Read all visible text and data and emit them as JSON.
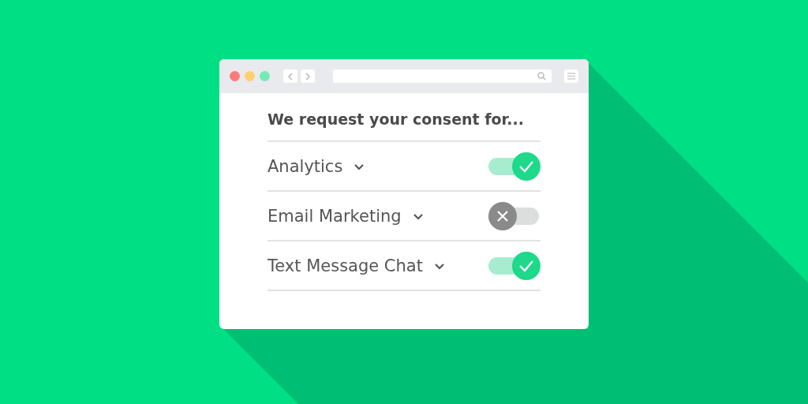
{
  "heading": "We request your consent for...",
  "items": [
    {
      "label": "Analytics",
      "on": true
    },
    {
      "label": "Email Marketing",
      "on": false
    },
    {
      "label": "Text Message Chat",
      "on": true
    }
  ]
}
